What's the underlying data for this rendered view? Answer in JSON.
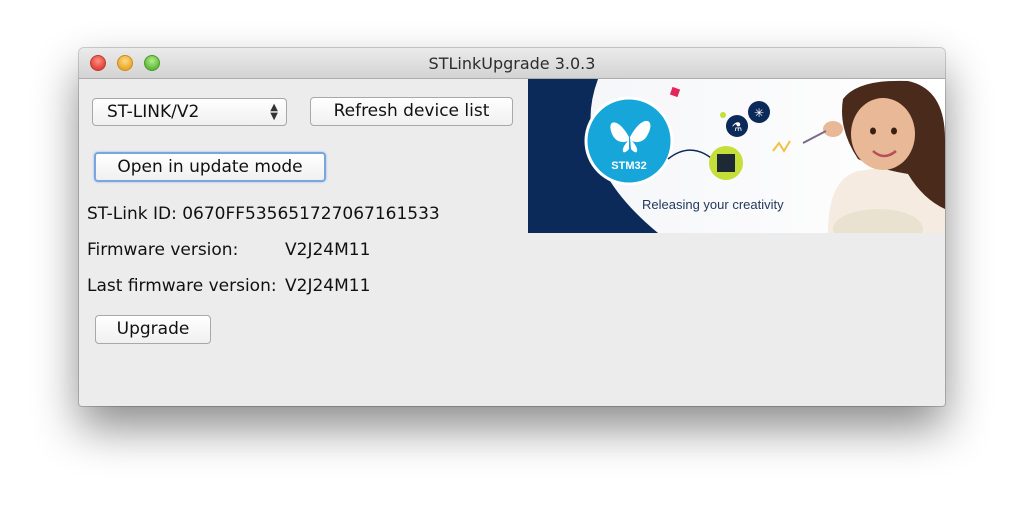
{
  "window": {
    "title": "STLinkUpgrade 3.0.3"
  },
  "device_select": {
    "value": "ST-LINK/V2"
  },
  "buttons": {
    "refresh": "Refresh device list",
    "open_update": "Open in update mode",
    "upgrade": "Upgrade"
  },
  "info": {
    "stlink_id_label": "ST-Link ID:",
    "stlink_id_value": "0670FF535651727067161533",
    "firmware_label": "Firmware version:",
    "firmware_value": "V2J24M11",
    "last_firmware_label": "Last firmware version:",
    "last_firmware_value": "V2J24M11"
  },
  "banner": {
    "logo_text": "STM32",
    "tagline": "Releasing your creativity",
    "colors": {
      "navy": "#0b2a5a",
      "cyan": "#17a6d9"
    }
  }
}
